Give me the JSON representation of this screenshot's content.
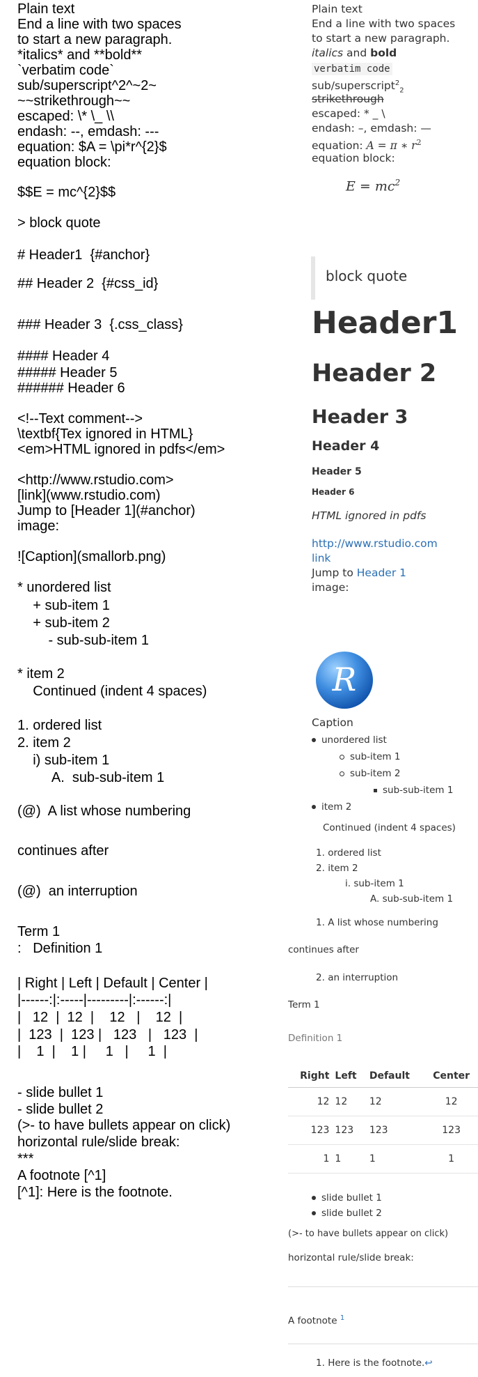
{
  "source": {
    "lines": [
      "Plain text",
      "End a line with two spaces",
      "to start a new paragraph.",
      "*italics* and **bold**",
      "`verbatim code`",
      "sub/superscript^2^~2~",
      "~~strikethrough~~",
      "escaped: \\* \\_ \\\\",
      "endash: --, emdash: ---",
      "equation: $A = \\pi*r^{2}$",
      "equation block:",
      "$$E = mc^{2}$$",
      "> block quote",
      "# Header1  {#anchor}",
      "## Header 2  {#css_id}",
      "### Header 3  {.css_class}",
      "#### Header 4",
      "##### Header 5",
      "###### Header 6",
      "<!--Text comment-->",
      "\\textbf{Tex ignored in HTML}",
      "<em>HTML ignored in pdfs</em>",
      "<http://www.rstudio.com>",
      "[link](www.rstudio.com)",
      "Jump to [Header 1](#anchor)",
      "image:",
      "![Caption](smallorb.png)",
      "* unordered list",
      "    + sub-item 1",
      "    + sub-item 2",
      "        - sub-sub-item 1",
      "* item 2",
      "    Continued (indent 4 spaces)",
      "1. ordered list",
      "2. item 2",
      "    i) sub-item 1",
      "         A.  sub-sub-item 1",
      "(@)  A list whose numbering",
      "continues after",
      "(@)  an interruption",
      "Term 1",
      ":   Definition 1",
      "| Right | Left | Default | Center |",
      "|------:|:-----|---------|:------:|",
      "|   12  |  12  |    12   |    12  |",
      "|  123  |  123 |   123   |   123  |",
      "|    1  |    1 |     1   |     1  |",
      "- slide bullet 1",
      "- slide bullet 2",
      "(>- to have bullets appear on click)",
      "horizontal rule/slide break:",
      "***",
      "A footnote [^1]",
      "[^1]: Here is the footnote."
    ]
  },
  "rendered": {
    "plain": "Plain text",
    "para1": "End a line with two spaces",
    "para2": "to start a new paragraph.",
    "italics": "italics",
    "and": " and ",
    "bold": "bold",
    "code": "verbatim code",
    "subsup": "sub/superscript",
    "sup": "2",
    "sub": "2",
    "strike": "strikethrough",
    "escaped": "escaped: * _ \\",
    "dashes": "endash: –, emdash: —",
    "eq_label": "equation: ",
    "eq_inline": "A = π ∗ r",
    "eq_inline_sup": "2",
    "eq_block_label": "equation block:",
    "eq_block": "E = mc",
    "eq_block_sup": "2",
    "quote": "block quote",
    "h1": "Header1",
    "h2": "Header 2",
    "h3": "Header 3",
    "h4": "Header 4",
    "h5": "Header 5",
    "h6": "Header 6",
    "html_em": "HTML ignored in pdfs",
    "url": "http://www.rstudio.com",
    "link": "link",
    "jump_prefix": "Jump to ",
    "jump_link": "Header 1",
    "image_label": "image:",
    "logo_letter": "R",
    "caption": "Caption",
    "ul1": "unordered list",
    "ul1a": "sub-item 1",
    "ul1b": "sub-item 2",
    "ul1b1": "sub-sub-item 1",
    "ul2": "item 2",
    "ul2c": "Continued (indent 4 spaces)",
    "ol1_num": "1.",
    "ol1": "ordered list",
    "ol2_num": "2.",
    "ol2": "item 2",
    "ol2i_num": "i.",
    "ol2i": "sub-item 1",
    "ol2iA_num": "A.",
    "ol2iA": "sub-sub-item 1",
    "ex1_num": "1.",
    "ex1": "A list whose numbering",
    "continues": "continues after",
    "ex2_num": "2.",
    "ex2": "an interruption",
    "term": "Term 1",
    "definition": "Definition 1",
    "table": {
      "headers": [
        "Right",
        "Left",
        "Default",
        "Center"
      ],
      "rows": [
        [
          "12",
          "12",
          "12",
          "12"
        ],
        [
          "123",
          "123",
          "123",
          "123"
        ],
        [
          "1",
          "1",
          "1",
          "1"
        ]
      ]
    },
    "sb1": "slide bullet 1",
    "sb2": "slide bullet 2",
    "click_note": "(>- to have bullets appear on click)",
    "hr_label": "horizontal rule/slide break:",
    "footnote_text": "A footnote ",
    "footnote_ref": "1",
    "fn_num": "1.",
    "fn_body": "Here is the footnote.",
    "fn_back": "↩"
  }
}
